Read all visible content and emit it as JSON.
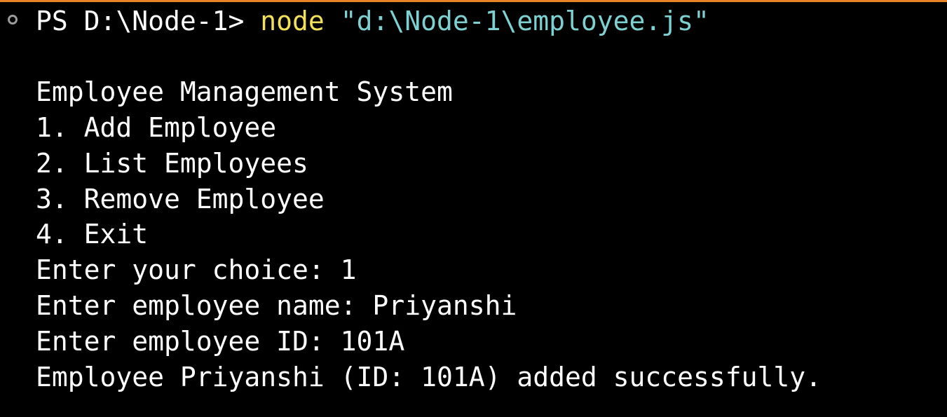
{
  "terminal": {
    "prompt_line": {
      "prompt": "PS D:\\Node-1> ",
      "command": "node",
      "argument": " \"d:\\Node-1\\employee.js\""
    },
    "output_lines": [
      "Employee Management System",
      "1. Add Employee",
      "2. List Employees",
      "3. Remove Employee",
      "4. Exit",
      "Enter your choice: 1",
      "Enter employee name: Priyanshi",
      "Enter employee ID: 101A",
      "Employee Priyanshi (ID: 101A) added successfully."
    ]
  },
  "icons": {
    "command_decoration": "circle-outline-icon"
  },
  "colors": {
    "background": "#000000",
    "text": "#ffffff",
    "command": "#f1e05a",
    "string": "#7fd1d1",
    "accent_border": "#e8832a",
    "decoration": "#9a9a9a"
  }
}
